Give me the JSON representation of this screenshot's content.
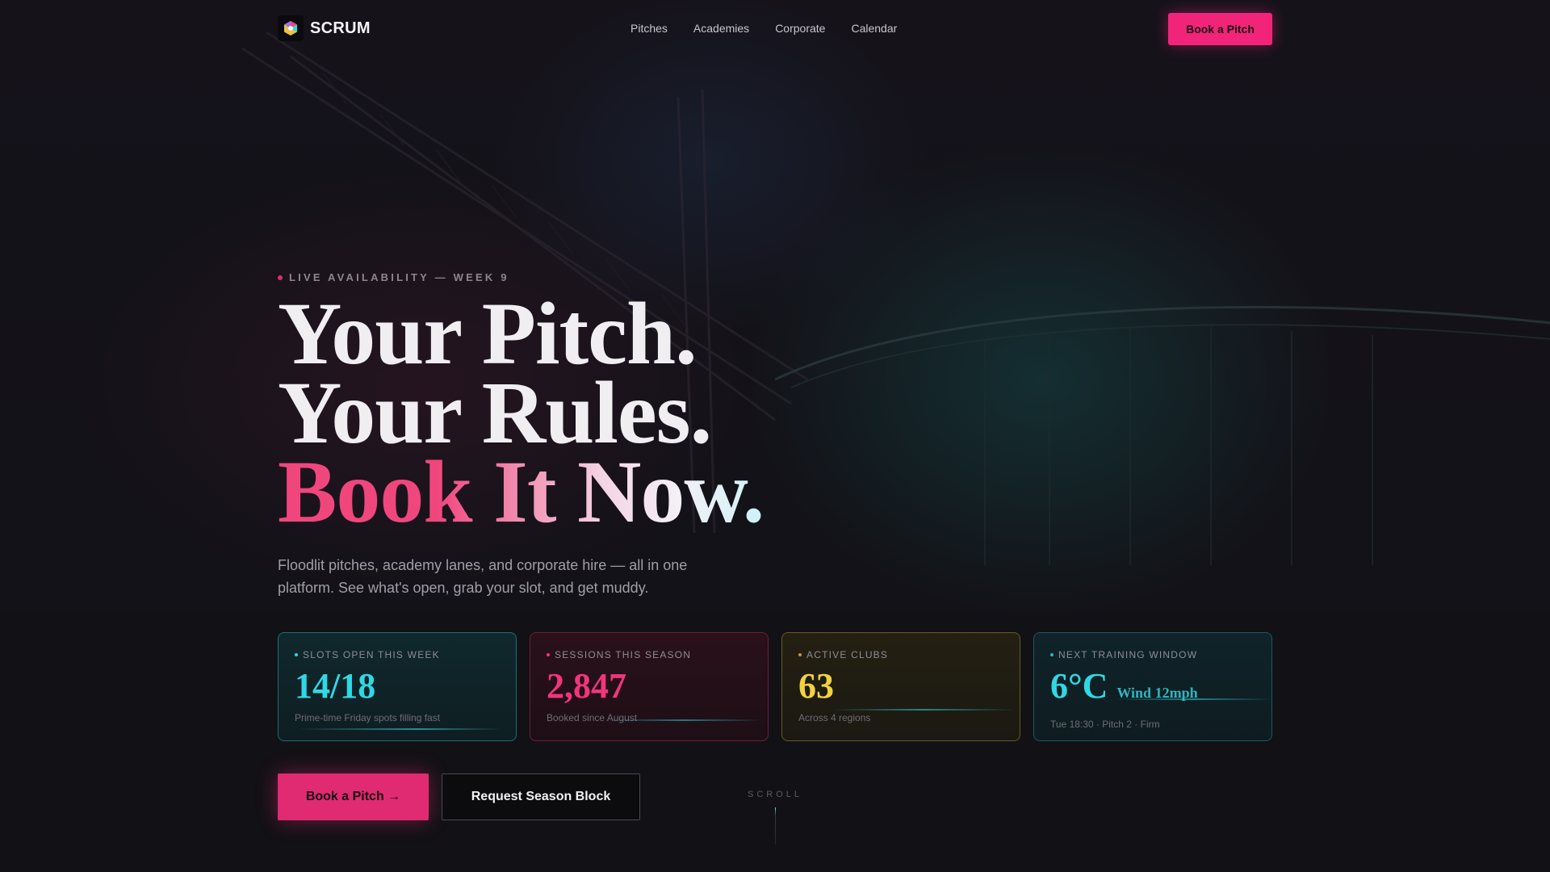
{
  "nav": {
    "brand": "SCRUM",
    "links": [
      "Pitches",
      "Academies",
      "Corporate",
      "Calendar"
    ],
    "cta": "Book a Pitch"
  },
  "hero": {
    "eyebrow": "LIVE AVAILABILITY — WEEK 9",
    "headline": [
      "Your Pitch.",
      "Your Rules.",
      "Book It Now."
    ],
    "subcopy": "Floodlit pitches, academy lanes, and corporate hire — all in one platform. See what's open, grab your slot, and get muddy."
  },
  "stats": [
    {
      "label": "SLOTS OPEN THIS WEEK",
      "value": "14/18",
      "sub": "Prime-time Friday spots filling fast",
      "color": "#2fd8e4"
    },
    {
      "label": "SESSIONS THIS SEASON",
      "value": "2,847",
      "sub": "Booked since August",
      "color": "#f0357c"
    },
    {
      "label": "ACTIVE CLUBS",
      "value": "63",
      "sub": "Across 4 regions",
      "color": "#f3d23e"
    },
    {
      "label": "NEXT TRAINING WINDOW",
      "value": "6°C",
      "unit": "Wind 12mph",
      "sub": "Tue 18:30 · Pitch 2 · Firm",
      "color": "#2fd8e4"
    }
  ],
  "actions": {
    "primary": "Book a Pitch →",
    "secondary": "Request Season Block"
  },
  "scroll_label": "SCROLL",
  "colors": {
    "accent": "#f2247a",
    "teal": "#2fd8e4",
    "gold": "#f3d23e",
    "background": "#141118"
  }
}
